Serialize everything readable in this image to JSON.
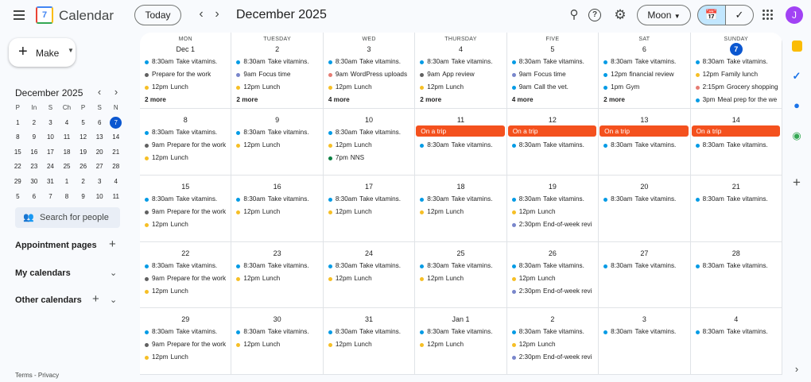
{
  "app": {
    "title": "Calendar",
    "logo_day": "7",
    "avatar_initial": "J"
  },
  "header": {
    "today_label": "Today",
    "prev_icon": "chevron-left-icon",
    "next_icon": "chevron-right-icon",
    "period_label": "December 2025",
    "view_label": "Moon",
    "calendar_view_icon": "calendar-icon",
    "tasks_view_icon": "check-circle-icon"
  },
  "sidebar": {
    "make_label": "Make",
    "mini_title": "December 2025",
    "mini_heads": [
      "P",
      "In",
      "S",
      "Ch",
      "P",
      "S",
      "N"
    ],
    "mini_weeks": [
      [
        "1",
        "2",
        "3",
        "4",
        "5",
        "6",
        "7"
      ],
      [
        "8",
        "9",
        "10",
        "11",
        "12",
        "13",
        "14"
      ],
      [
        "15",
        "16",
        "17",
        "18",
        "19",
        "20",
        "21"
      ],
      [
        "22",
        "23",
        "24",
        "25",
        "26",
        "27",
        "28"
      ],
      [
        "29",
        "30",
        "31",
        "1",
        "2",
        "3",
        "4"
      ],
      [
        "5",
        "6",
        "7",
        "8",
        "9",
        "10",
        "11"
      ]
    ],
    "mini_selected": "7",
    "search_placeholder": "Search for people",
    "sections": [
      "Appointment pages",
      "My calendars",
      "Other calendars"
    ],
    "footer": "Terms - Privacy"
  },
  "colors": {
    "blue": "#039be5",
    "graphite": "#616161",
    "yellow": "#f6bf26",
    "lavender": "#7986cb",
    "tomato": "#e67c73",
    "green": "#0b8043",
    "trip": "#f4511e",
    "today": "#0b57d0"
  },
  "trip_label": "On a trip",
  "weeks": [
    {
      "days": [
        {
          "dow": "MON",
          "num": "Dec 1",
          "events": [
            [
              "8:30am",
              "Take vitamins.",
              "blue"
            ],
            [
              "",
              "Prepare for the work",
              "graphite"
            ],
            [
              "12pm",
              "Lunch",
              "yellow"
            ]
          ],
          "more": "2 more"
        },
        {
          "dow": "TUESDAY",
          "num": "2",
          "events": [
            [
              "8:30am",
              "Take vitamins.",
              "blue"
            ],
            [
              "9am",
              "Focus time",
              "lavender"
            ],
            [
              "12pm",
              "Lunch",
              "yellow"
            ]
          ],
          "more": "2 more"
        },
        {
          "dow": "WED",
          "num": "3",
          "events": [
            [
              "8:30am",
              "Take vitamins.",
              "blue"
            ],
            [
              "9am",
              "WordPress uploads",
              "tomato"
            ],
            [
              "12pm",
              "Lunch",
              "yellow"
            ]
          ],
          "more": "4 more"
        },
        {
          "dow": "THURSDAY",
          "num": "4",
          "events": [
            [
              "8:30am",
              "Take vitamins.",
              "blue"
            ],
            [
              "9am",
              "App review",
              "graphite"
            ],
            [
              "12pm",
              "Lunch",
              "yellow"
            ]
          ],
          "more": "2 more"
        },
        {
          "dow": "FIVE",
          "num": "5",
          "events": [
            [
              "8:30am",
              "Take vitamins.",
              "blue"
            ],
            [
              "9am",
              "Focus time",
              "lavender"
            ],
            [
              "9am",
              "Call the vet.",
              "blue"
            ]
          ],
          "more": "4 more"
        },
        {
          "dow": "SAT",
          "num": "6",
          "events": [
            [
              "8:30am",
              "Take vitamins.",
              "blue"
            ],
            [
              "12pm",
              "financial review",
              "blue"
            ],
            [
              "1pm",
              "Gym",
              "blue"
            ]
          ],
          "more": "2 more"
        },
        {
          "dow": "SUNDAY",
          "num": "7",
          "today": true,
          "events": [
            [
              "8:30am",
              "Take vitamins.",
              "blue"
            ],
            [
              "12pm",
              "Family lunch",
              "yellow"
            ],
            [
              "2:15pm",
              "Grocery shopping",
              "tomato"
            ],
            [
              "3pm",
              "Meal prep for the we",
              "blue"
            ]
          ],
          "more": ""
        }
      ]
    },
    {
      "days": [
        {
          "num": "8",
          "events": [
            [
              "8:30am",
              "Take vitamins.",
              "blue"
            ],
            [
              "9am",
              "Prepare for the work",
              "graphite"
            ],
            [
              "12pm",
              "Lunch",
              "yellow"
            ]
          ]
        },
        {
          "num": "9",
          "events": [
            [
              "8:30am",
              "Take vitamins.",
              "blue"
            ],
            [
              "12pm",
              "Lunch",
              "yellow"
            ]
          ]
        },
        {
          "num": "10",
          "events": [
            [
              "8:30am",
              "Take vitamins.",
              "blue"
            ],
            [
              "12pm",
              "Lunch",
              "yellow"
            ],
            [
              "7pm",
              "NNS",
              "green"
            ]
          ]
        },
        {
          "num": "11",
          "trip": true,
          "events": [
            [
              "8:30am",
              "Take vitamins.",
              "blue"
            ]
          ]
        },
        {
          "num": "12",
          "trip": true,
          "events": [
            [
              "8:30am",
              "Take vitamins.",
              "blue"
            ]
          ]
        },
        {
          "num": "13",
          "trip": true,
          "events": [
            [
              "8:30am",
              "Take vitamins.",
              "blue"
            ]
          ]
        },
        {
          "num": "14",
          "trip": true,
          "events": [
            [
              "8:30am",
              "Take vitamins.",
              "blue"
            ]
          ]
        }
      ]
    },
    {
      "days": [
        {
          "num": "15",
          "events": [
            [
              "8:30am",
              "Take vitamins.",
              "blue"
            ],
            [
              "9am",
              "Prepare for the work",
              "graphite"
            ],
            [
              "12pm",
              "Lunch",
              "yellow"
            ]
          ]
        },
        {
          "num": "16",
          "events": [
            [
              "8:30am",
              "Take vitamins.",
              "blue"
            ],
            [
              "12pm",
              "Lunch",
              "yellow"
            ]
          ]
        },
        {
          "num": "17",
          "events": [
            [
              "8:30am",
              "Take vitamins.",
              "blue"
            ],
            [
              "12pm",
              "Lunch",
              "yellow"
            ]
          ]
        },
        {
          "num": "18",
          "events": [
            [
              "8:30am",
              "Take vitamins.",
              "blue"
            ],
            [
              "12pm",
              "Lunch",
              "yellow"
            ]
          ]
        },
        {
          "num": "19",
          "events": [
            [
              "8:30am",
              "Take vitamins.",
              "blue"
            ],
            [
              "12pm",
              "Lunch",
              "yellow"
            ],
            [
              "2:30pm",
              "End-of-week revi",
              "lavender"
            ]
          ]
        },
        {
          "num": "20",
          "events": [
            [
              "8:30am",
              "Take vitamins.",
              "blue"
            ]
          ]
        },
        {
          "num": "21",
          "events": [
            [
              "8:30am",
              "Take vitamins.",
              "blue"
            ]
          ]
        }
      ]
    },
    {
      "days": [
        {
          "num": "22",
          "events": [
            [
              "8:30am",
              "Take vitamins.",
              "blue"
            ],
            [
              "9am",
              "Prepare for the work",
              "graphite"
            ],
            [
              "12pm",
              "Lunch",
              "yellow"
            ]
          ]
        },
        {
          "num": "23",
          "events": [
            [
              "8:30am",
              "Take vitamins.",
              "blue"
            ],
            [
              "12pm",
              "Lunch",
              "yellow"
            ]
          ]
        },
        {
          "num": "24",
          "events": [
            [
              "8:30am",
              "Take vitamins.",
              "blue"
            ],
            [
              "12pm",
              "Lunch",
              "yellow"
            ]
          ]
        },
        {
          "num": "25",
          "events": [
            [
              "8:30am",
              "Take vitamins.",
              "blue"
            ],
            [
              "12pm",
              "Lunch",
              "yellow"
            ]
          ]
        },
        {
          "num": "26",
          "events": [
            [
              "8:30am",
              "Take vitamins.",
              "blue"
            ],
            [
              "12pm",
              "Lunch",
              "yellow"
            ],
            [
              "2:30pm",
              "End-of-week revi",
              "lavender"
            ]
          ]
        },
        {
          "num": "27",
          "events": [
            [
              "8:30am",
              "Take vitamins.",
              "blue"
            ]
          ]
        },
        {
          "num": "28",
          "events": [
            [
              "8:30am",
              "Take vitamins.",
              "blue"
            ]
          ]
        }
      ]
    },
    {
      "days": [
        {
          "num": "29",
          "events": [
            [
              "8:30am",
              "Take vitamins.",
              "blue"
            ],
            [
              "9am",
              "Prepare for the work",
              "graphite"
            ],
            [
              "12pm",
              "Lunch",
              "yellow"
            ]
          ]
        },
        {
          "num": "30",
          "events": [
            [
              "8:30am",
              "Take vitamins.",
              "blue"
            ],
            [
              "12pm",
              "Lunch",
              "yellow"
            ]
          ]
        },
        {
          "num": "31",
          "events": [
            [
              "8:30am",
              "Take vitamins.",
              "blue"
            ],
            [
              "12pm",
              "Lunch",
              "yellow"
            ]
          ]
        },
        {
          "num": "Jan 1",
          "events": [
            [
              "8:30am",
              "Take vitamins.",
              "blue"
            ],
            [
              "12pm",
              "Lunch",
              "yellow"
            ]
          ]
        },
        {
          "num": "2",
          "events": [
            [
              "8:30am",
              "Take vitamins.",
              "blue"
            ],
            [
              "12pm",
              "Lunch",
              "yellow"
            ],
            [
              "2:30pm",
              "End-of-week revi",
              "lavender"
            ]
          ]
        },
        {
          "num": "3",
          "events": [
            [
              "8:30am",
              "Take vitamins.",
              "blue"
            ]
          ]
        },
        {
          "num": "4",
          "events": [
            [
              "8:30am",
              "Take vitamins.",
              "blue"
            ]
          ]
        }
      ]
    }
  ],
  "right_rail": [
    "keep-icon",
    "tasks-icon",
    "contacts-icon",
    "maps-icon",
    "add-icon",
    "expand-icon"
  ]
}
